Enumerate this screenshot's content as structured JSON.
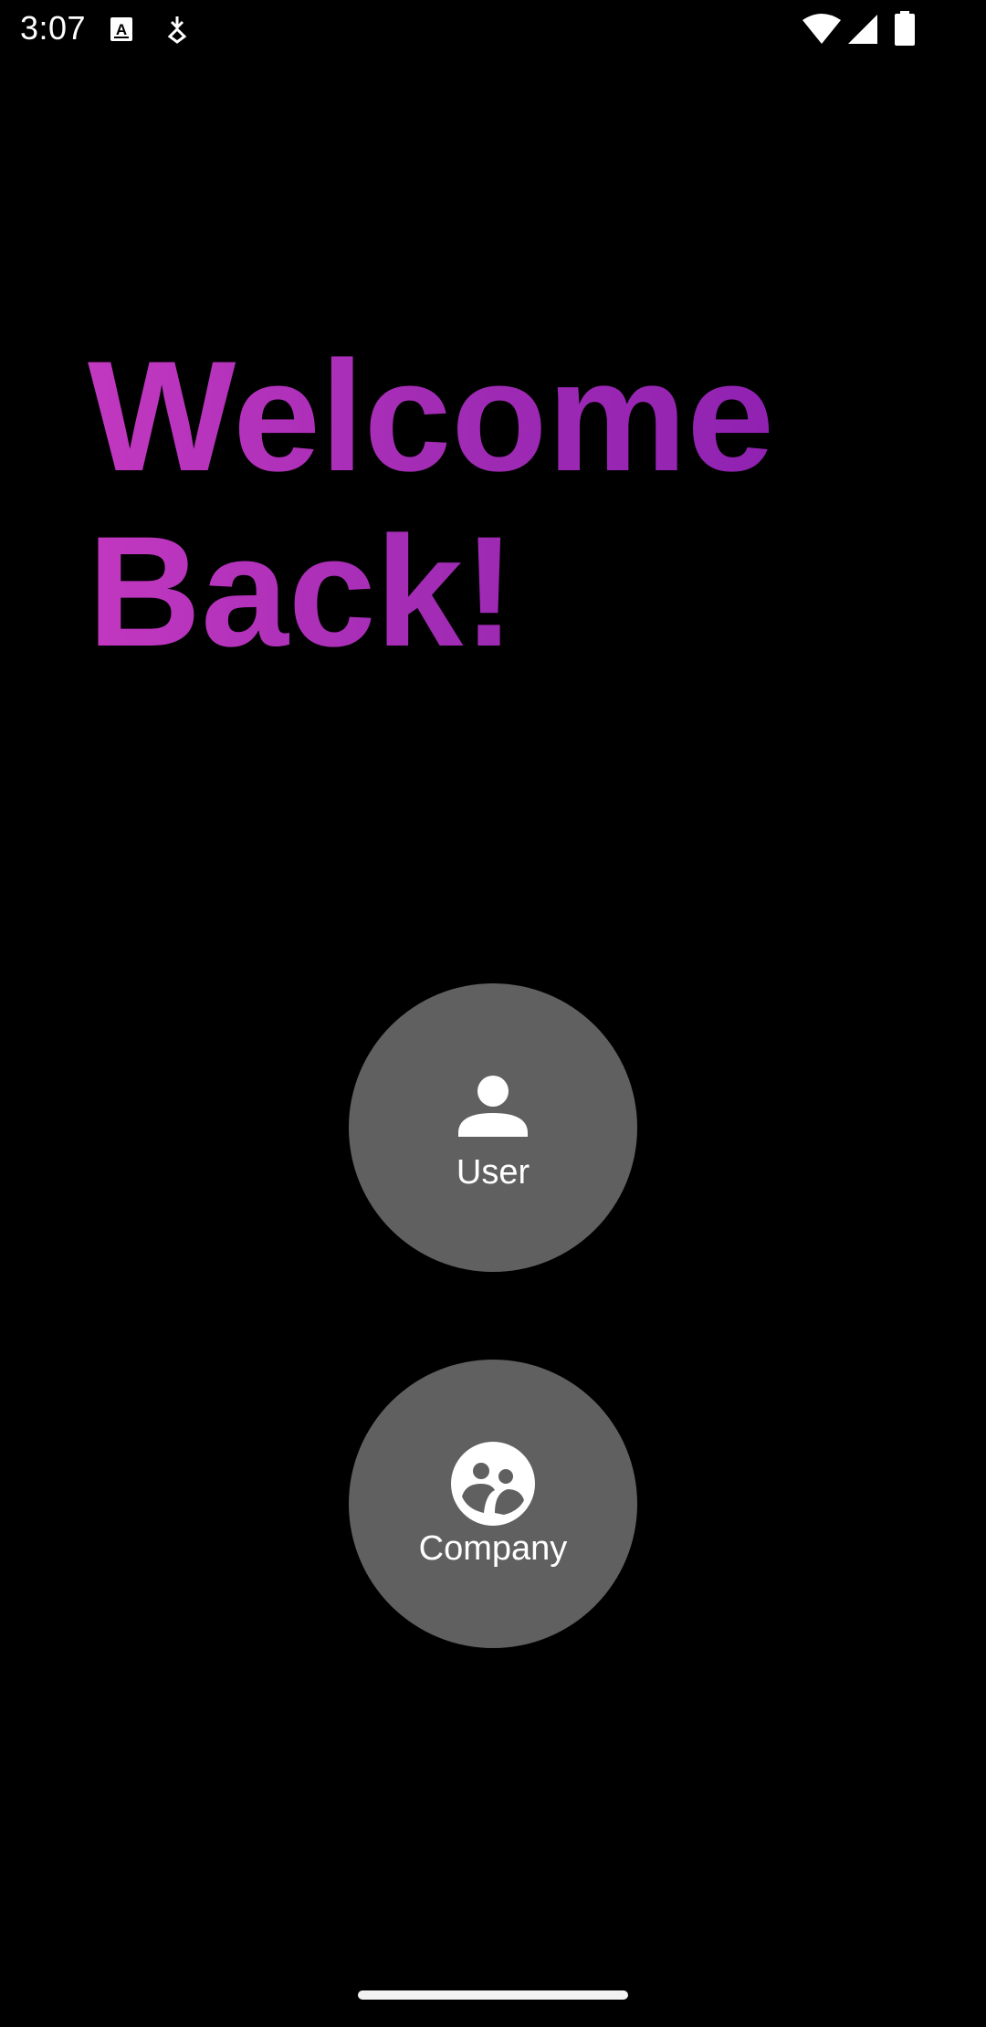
{
  "status_bar": {
    "time": "3:07",
    "icons": [
      "notification-a-icon",
      "notification-download-icon",
      "wifi-icon",
      "cell-signal-icon",
      "battery-icon"
    ]
  },
  "welcome": {
    "line1": "Welcome",
    "line2": "Back!",
    "gradient_start": "#c238c0",
    "gradient_end": "#8a1eb0"
  },
  "roles": {
    "user": {
      "label": "User",
      "icon": "person-icon"
    },
    "company": {
      "label": "Company",
      "icon": "group-icon"
    }
  },
  "colors": {
    "background": "#000000",
    "button": "#606060",
    "text": "#ffffff"
  }
}
